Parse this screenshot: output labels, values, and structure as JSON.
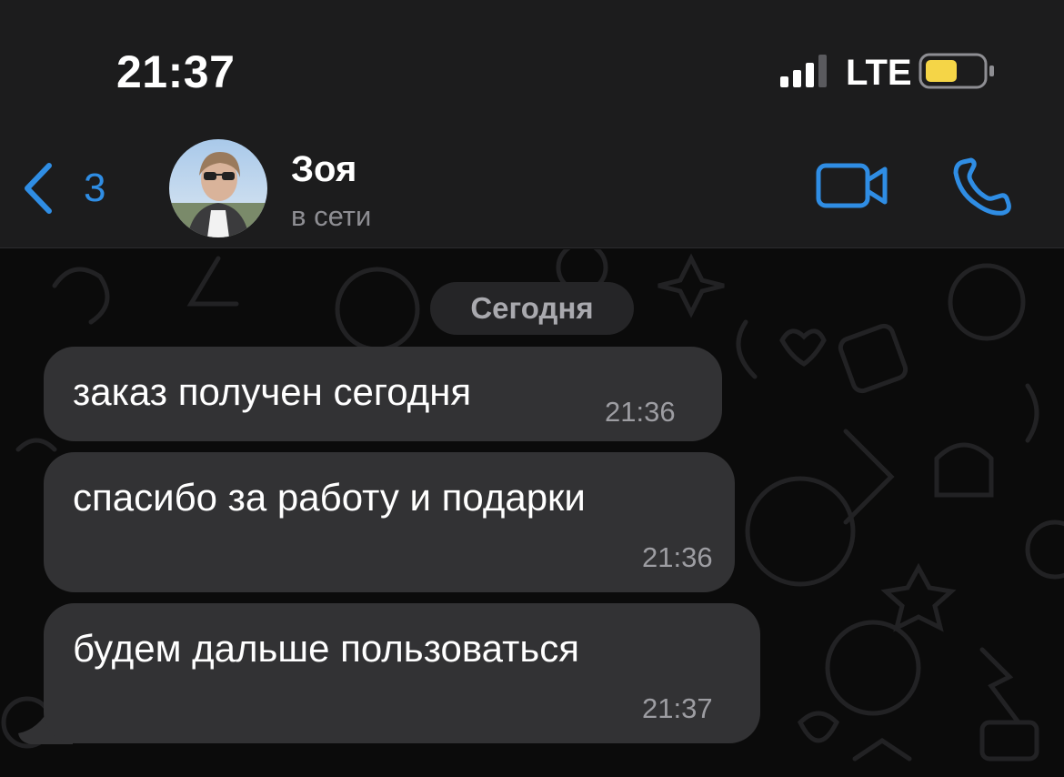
{
  "status_bar": {
    "time": "21:37",
    "network": "LTE",
    "battery_color": "#f5d547"
  },
  "header": {
    "back_count": "3",
    "contact_name": "Зоя",
    "contact_status": "в сети",
    "accent_color": "#2f8de4",
    "icons": [
      "chevron-left-icon",
      "video-camera-icon",
      "phone-icon"
    ]
  },
  "chat": {
    "date_separator": "Сегодня",
    "messages": [
      {
        "text": "заказ получен сегодня",
        "time": "21:36"
      },
      {
        "text": "спасибо за работу и подарки",
        "time": "21:36"
      },
      {
        "text": "будем дальше пользоваться",
        "time": "21:37"
      }
    ]
  }
}
